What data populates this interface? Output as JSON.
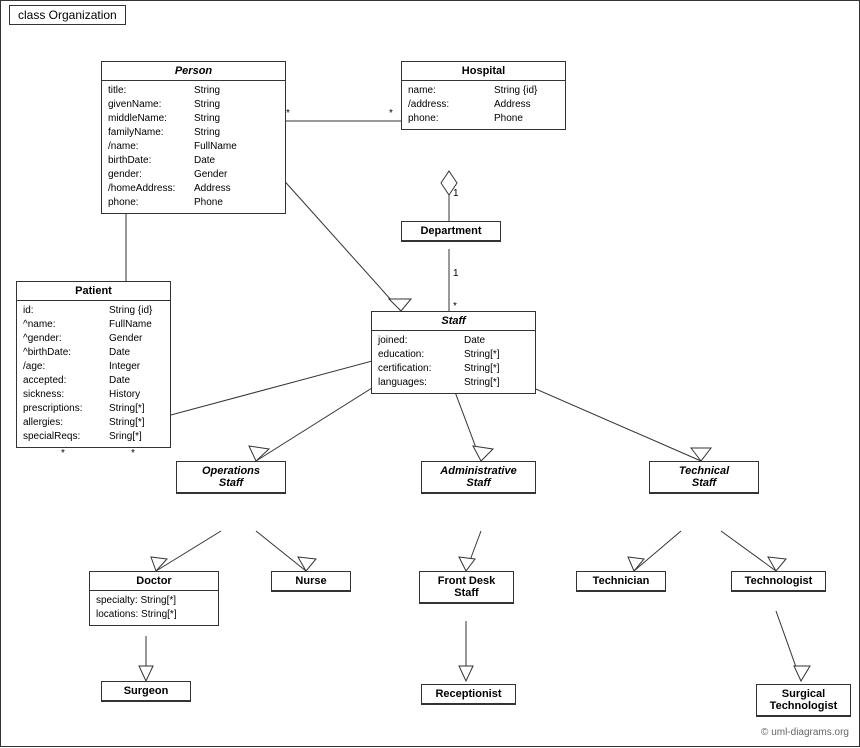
{
  "diagram": {
    "title": "class Organization",
    "classes": {
      "person": {
        "name": "Person",
        "italic": true,
        "attrs": [
          {
            "name": "title:",
            "type": "String"
          },
          {
            "name": "givenName:",
            "type": "String"
          },
          {
            "name": "middleName:",
            "type": "String"
          },
          {
            "name": "familyName:",
            "type": "String"
          },
          {
            "name": "/name:",
            "type": "FullName"
          },
          {
            "name": "birthDate:",
            "type": "Date"
          },
          {
            "name": "gender:",
            "type": "Gender"
          },
          {
            "name": "/homeAddress:",
            "type": "Address"
          },
          {
            "name": "phone:",
            "type": "Phone"
          }
        ]
      },
      "hospital": {
        "name": "Hospital",
        "italic": false,
        "attrs": [
          {
            "name": "name:",
            "type": "String {id}"
          },
          {
            "name": "/address:",
            "type": "Address"
          },
          {
            "name": "phone:",
            "type": "Phone"
          }
        ]
      },
      "department": {
        "name": "Department",
        "italic": false,
        "attrs": []
      },
      "staff": {
        "name": "Staff",
        "italic": true,
        "attrs": [
          {
            "name": "joined:",
            "type": "Date"
          },
          {
            "name": "education:",
            "type": "String[*]"
          },
          {
            "name": "certification:",
            "type": "String[*]"
          },
          {
            "name": "languages:",
            "type": "String[*]"
          }
        ]
      },
      "patient": {
        "name": "Patient",
        "italic": false,
        "attrs": [
          {
            "name": "id:",
            "type": "String {id}"
          },
          {
            "name": "^name:",
            "type": "FullName"
          },
          {
            "name": "^gender:",
            "type": "Gender"
          },
          {
            "name": "^birthDate:",
            "type": "Date"
          },
          {
            "name": "/age:",
            "type": "Integer"
          },
          {
            "name": "accepted:",
            "type": "Date"
          },
          {
            "name": "sickness:",
            "type": "History"
          },
          {
            "name": "prescriptions:",
            "type": "String[*]"
          },
          {
            "name": "allergies:",
            "type": "String[*]"
          },
          {
            "name": "specialReqs:",
            "type": "Sring[*]"
          }
        ]
      },
      "operations_staff": {
        "name": "Operations Staff",
        "italic": true
      },
      "administrative_staff": {
        "name": "Administrative Staff",
        "italic": true
      },
      "technical_staff": {
        "name": "Technical Staff",
        "italic": true
      },
      "doctor": {
        "name": "Doctor",
        "italic": false,
        "attrs": [
          {
            "name": "specialty:",
            "type": "String[*]"
          },
          {
            "name": "locations:",
            "type": "String[*]"
          }
        ]
      },
      "nurse": {
        "name": "Nurse",
        "italic": false,
        "attrs": []
      },
      "front_desk_staff": {
        "name": "Front Desk Staff",
        "italic": false,
        "attrs": []
      },
      "technician": {
        "name": "Technician",
        "italic": false,
        "attrs": []
      },
      "technologist": {
        "name": "Technologist",
        "italic": false,
        "attrs": []
      },
      "surgeon": {
        "name": "Surgeon",
        "italic": false,
        "attrs": []
      },
      "receptionist": {
        "name": "Receptionist",
        "italic": false,
        "attrs": []
      },
      "surgical_technologist": {
        "name": "Surgical Technologist",
        "italic": false,
        "attrs": []
      }
    },
    "watermark": "© uml-diagrams.org"
  }
}
